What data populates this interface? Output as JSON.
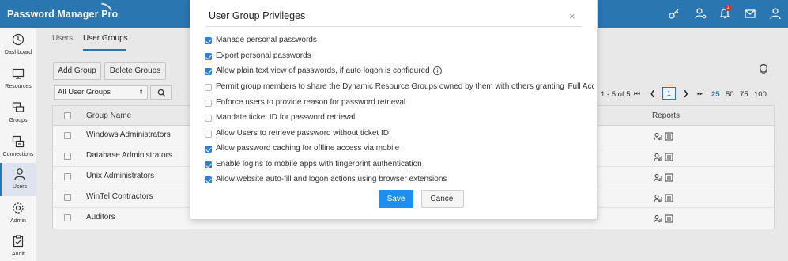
{
  "app": {
    "brand": "Password Manager Pro"
  },
  "sidebar": {
    "items": [
      {
        "label": "Dashboard",
        "icon": "clock-icon"
      },
      {
        "label": "Resources",
        "icon": "monitor-icon"
      },
      {
        "label": "Groups",
        "icon": "groups-icon"
      },
      {
        "label": "Connections",
        "icon": "connections-icon"
      },
      {
        "label": "Users",
        "icon": "user-icon",
        "active": true
      },
      {
        "label": "Admin",
        "icon": "gear-icon"
      },
      {
        "label": "Audit",
        "icon": "clipboard-icon"
      }
    ]
  },
  "tabs": {
    "users": "Users",
    "user_groups": "User Groups"
  },
  "toolbar": {
    "add_group": "Add Group",
    "delete_groups": "Delete Groups",
    "filter_value": "All User Groups"
  },
  "pager": {
    "range": "1 - 5 of 5",
    "current_page": "1",
    "page_sizes": [
      "25",
      "50",
      "75",
      "100"
    ],
    "active_size": "25"
  },
  "table": {
    "headers": {
      "name": "Group Name",
      "reports": "Reports"
    },
    "rows": [
      {
        "name": "Windows Administrators"
      },
      {
        "name": "Database Administrators"
      },
      {
        "name": "Unix Administrators"
      },
      {
        "name": "WinTel Contractors"
      },
      {
        "name": "Auditors"
      }
    ]
  },
  "modal": {
    "title": "User Group Privileges",
    "close": "×",
    "options": [
      {
        "label": "Manage personal passwords",
        "checked": true
      },
      {
        "label": "Export personal passwords",
        "checked": true
      },
      {
        "label": "Allow plain text view of passwords, if auto logon is configured",
        "checked": true,
        "info": "i"
      },
      {
        "label": "Permit group members to share the Dynamic Resource Groups owned by them with others granting 'Full Access' p",
        "checked": false
      },
      {
        "label": "Enforce users to provide reason for password retrieval",
        "checked": false
      },
      {
        "label": "Mandate ticket ID for password retrieval",
        "checked": false
      },
      {
        "label": "Allow Users to retrieve password without ticket ID",
        "checked": false
      },
      {
        "label": "Allow password caching for offline access via mobile",
        "checked": true
      },
      {
        "label": "Enable logins to mobile apps with fingerprint authentication",
        "checked": true
      },
      {
        "label": "Allow website auto-fill and logon actions using browser extensions",
        "checked": true
      }
    ],
    "save": "Save",
    "cancel": "Cancel"
  },
  "colors": {
    "header": "#2c7bb8",
    "primary_button": "#1f8ef1",
    "checkbox": "#2f7fd1"
  }
}
